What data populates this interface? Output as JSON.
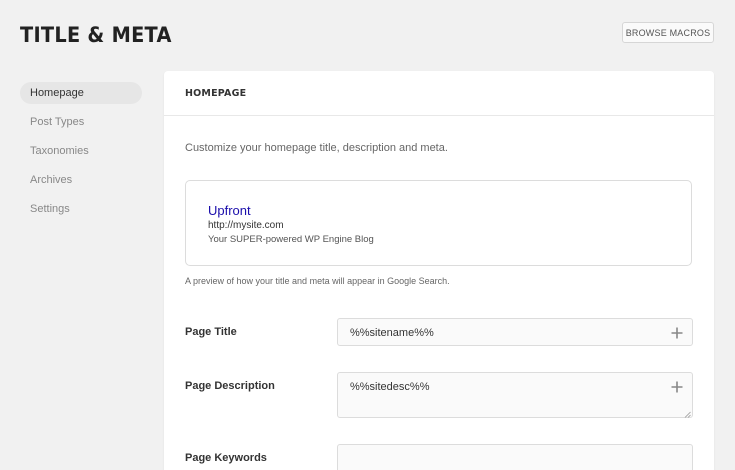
{
  "header": {
    "title": "TITLE & META",
    "browse_label": "BROWSE MACROS"
  },
  "sidebar": {
    "items": [
      {
        "label": "Homepage",
        "active": true
      },
      {
        "label": "Post Types",
        "active": false
      },
      {
        "label": "Taxonomies",
        "active": false
      },
      {
        "label": "Archives",
        "active": false
      },
      {
        "label": "Settings",
        "active": false
      }
    ]
  },
  "panel": {
    "heading": "HOMEPAGE",
    "intro": "Customize your homepage title, description and meta.",
    "preview": {
      "title": "Upfront",
      "url": "http://mysite.com",
      "description": "Your SUPER-powered WP Engine Blog",
      "note": "A preview of how your title and meta will appear in Google Search."
    },
    "fields": {
      "page_title": {
        "label": "Page Title",
        "value": "%%sitename%%"
      },
      "page_description": {
        "label": "Page Description",
        "value": "%%sitedesc%%"
      },
      "page_keywords": {
        "label": "Page Keywords",
        "value": ""
      }
    }
  },
  "colors": {
    "background": "#f1f1f1",
    "panel": "#ffffff",
    "link_blue": "#1a0dab"
  },
  "icons": [
    "plus-icon",
    "resize-handle-icon"
  ]
}
